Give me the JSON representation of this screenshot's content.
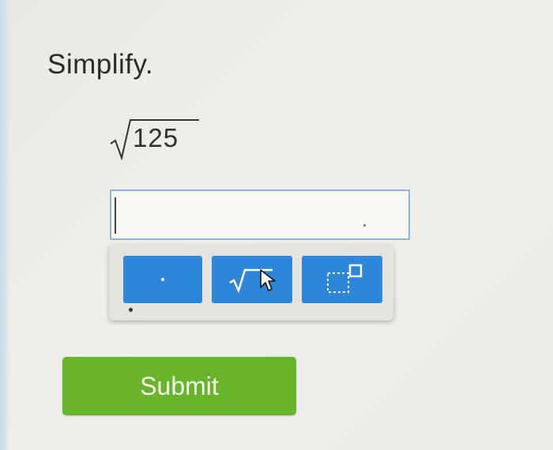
{
  "question": {
    "instruction": "Simplify.",
    "radicand": "125"
  },
  "answer": {
    "value": "",
    "placeholder": ""
  },
  "keypad": {
    "keys": [
      {
        "name": "decimal-point",
        "icon": "dot-icon"
      },
      {
        "name": "square-root",
        "icon": "sqrt-icon"
      },
      {
        "name": "exponent",
        "icon": "exponent-icon"
      }
    ]
  },
  "submit": {
    "label": "Submit"
  },
  "colors": {
    "key_blue": "#2e86d8",
    "submit_green": "#68b52c",
    "input_border": "#8fb2df"
  }
}
